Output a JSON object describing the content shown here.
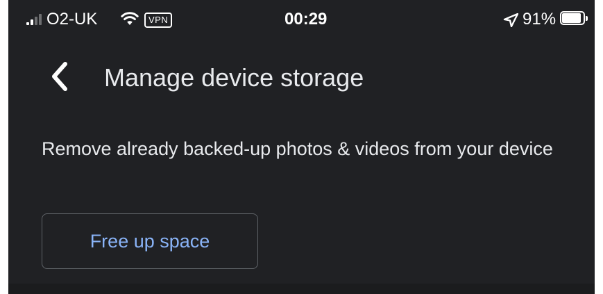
{
  "status_bar": {
    "carrier": "O2-UK",
    "vpn_label": "VPN",
    "time": "00:29",
    "battery_percent": "91%",
    "battery_level": 0.91,
    "signal_bars_active": 2,
    "signal_bars_total": 4,
    "icons": {
      "signal": "cellular-signal-icon",
      "wifi": "wifi-icon",
      "location": "location-arrow-icon",
      "battery": "battery-icon"
    }
  },
  "app_bar": {
    "back_icon": "chevron-left-icon",
    "title": "Manage device storage"
  },
  "main": {
    "description": "Remove already backed-up photos & videos from your device",
    "free_up_button_label": "Free up space"
  },
  "colors": {
    "background": "#202124",
    "text_primary": "#e8eaed",
    "accent_blue": "#8ab4f8",
    "button_border": "#5f6368",
    "status_text": "#ffffff"
  }
}
